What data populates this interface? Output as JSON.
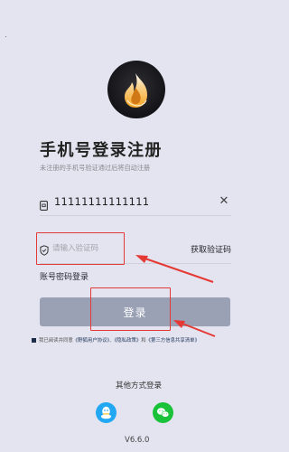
{
  "header": {
    "title": "手机号登录注册",
    "subtitle": "未注册的手机号验证通过后将自动注册"
  },
  "phone": {
    "value": "11111111111111"
  },
  "code": {
    "placeholder": "请输入验证码",
    "get_code_label": "获取验证码"
  },
  "password_login_label": "账号密码登录",
  "login_button_label": "登录",
  "agreement": {
    "prefix": "我已阅读并同意",
    "user_agreement": "《野狐用户协议》",
    "sep1": "、",
    "privacy_policy": "《隐私政策》",
    "sep2": "和",
    "third_party": "《第三方信息共享清单》"
  },
  "other_login_label": "其他方式登录",
  "version": "V6.6.0",
  "colors": {
    "background": "#e3e4ef",
    "login_button": "#9aa1b5",
    "annotation": "#e53935",
    "qq": "#22a7f2",
    "wechat": "#1ac23a"
  },
  "icons": [
    "app-logo",
    "phone-icon",
    "clear-icon",
    "shield-icon",
    "qq-icon",
    "wechat-icon"
  ]
}
